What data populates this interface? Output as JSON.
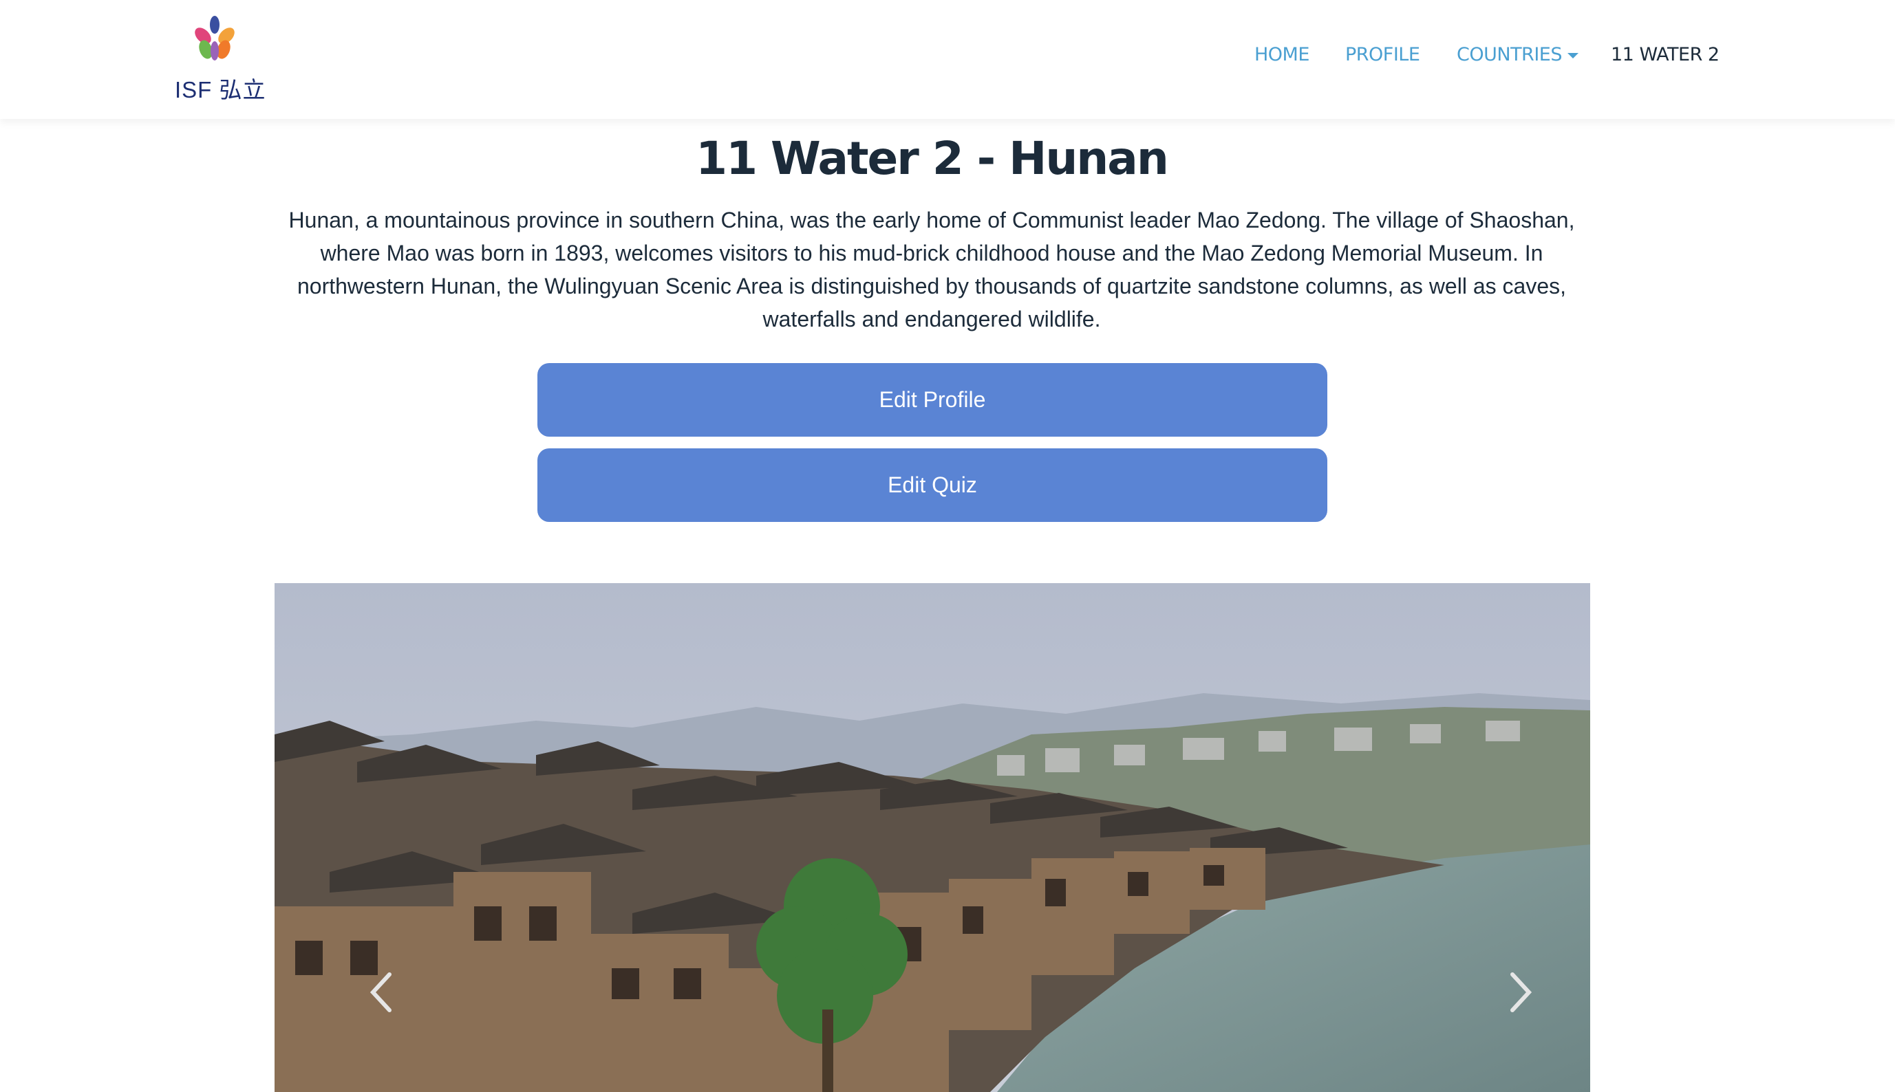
{
  "brand": {
    "logo_text": "ISF 弘立"
  },
  "nav": {
    "home": "HOME",
    "profile": "PROFILE",
    "countries": "COUNTRIES",
    "current": "11 WATER 2"
  },
  "page": {
    "title": "11 Water 2 - Hunan",
    "description": "Hunan, a mountainous province in southern China, was the early home of Communist leader Mao Zedong. The village of Shaoshan, where Mao was born in 1893, welcomes visitors to his mud-brick childhood house and the Mao Zedong Memorial Museum. In northwestern Hunan, the Wulingyuan Scenic Area is distinguished by thousands of quartzite sandstone columns, as well as caves, waterfalls and endangered wildlife."
  },
  "buttons": {
    "edit_profile": "Edit Profile",
    "edit_quiz": "Edit Quiz"
  },
  "carousel": {
    "prev_icon": "chevron-left-icon",
    "next_icon": "chevron-right-icon"
  },
  "colors": {
    "nav_link": "#4a9fd1",
    "nav_active": "#1c2b3a",
    "button": "#5a84d4",
    "title": "#1c2b3a"
  }
}
